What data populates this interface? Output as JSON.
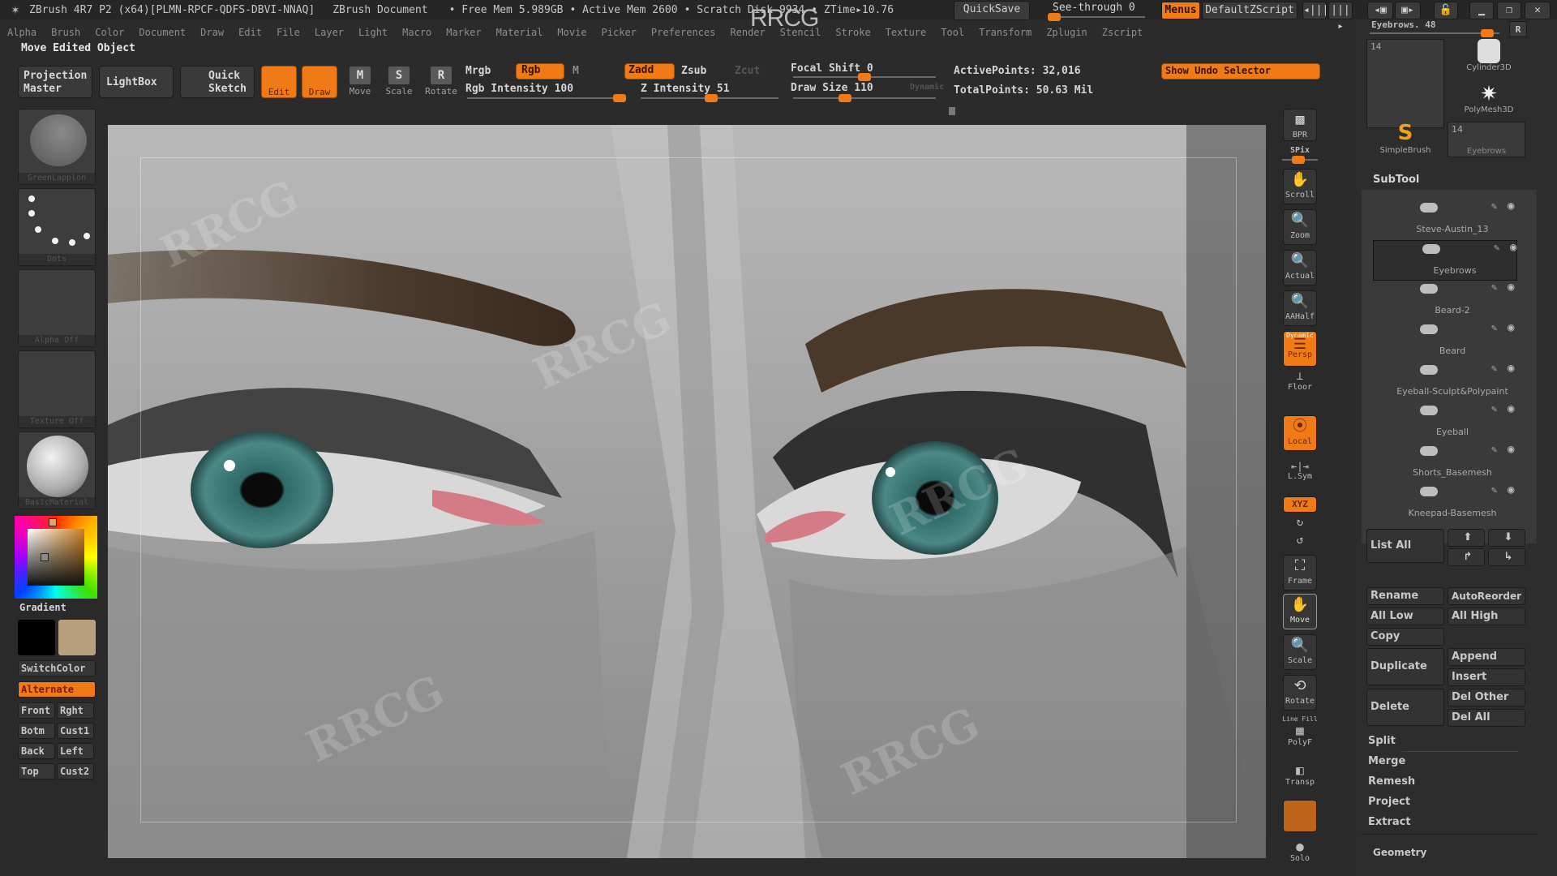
{
  "titlebar": {
    "app_title": "ZBrush 4R7 P2 (x64)[PLMN-RPCF-QDFS-DBVI-NNAQ]",
    "document": "ZBrush Document",
    "free_mem": "• Free Mem 5.989GB",
    "active_mem": "• Active Mem 2600",
    "scratch_disk": "• Scratch Disk 9934",
    "ztime": "• ZTime▸10.76",
    "quicksave": "QuickSave",
    "see_through_label": "See-through",
    "see_through_value": "0",
    "see_through_fraction": 0.0,
    "menus": "Menus",
    "default_zscript": "DefaultZScript",
    "watermark": "RRCG"
  },
  "menubar": [
    "Alpha",
    "Brush",
    "Color",
    "Document",
    "Draw",
    "Edit",
    "File",
    "Layer",
    "Light",
    "Macro",
    "Marker",
    "Material",
    "Movie",
    "Picker",
    "Preferences",
    "Render",
    "Stencil",
    "Stroke",
    "Texture",
    "Tool",
    "Transform",
    "Zplugin",
    "Zscript"
  ],
  "status_title": "Move Edited Object",
  "toolbar": {
    "projection_master": "Projection Master",
    "lightbox": "LightBox",
    "quick_sketch": "Quick Sketch",
    "edit": "Edit",
    "draw": "Draw",
    "move": "Move",
    "scale": "Scale",
    "rotate": "Rotate",
    "mrgb": "Mrgb",
    "rgb": "Rgb",
    "m": "M",
    "rgb_intensity_label": "Rgb Intensity",
    "rgb_intensity_value": "100",
    "rgb_intensity_fraction": 1.0,
    "zadd": "Zadd",
    "zsub": "Zsub",
    "zcut": "Zcut",
    "z_intensity_label": "Z Intensity",
    "z_intensity_value": "51",
    "z_intensity_fraction": 0.51,
    "focal_shift_label": "Focal Shift",
    "focal_shift_value": "0",
    "focal_shift_fraction": 0.5,
    "draw_size_label": "Draw Size",
    "draw_size_value": "110",
    "draw_size_fraction": 0.35,
    "dynamic": "Dynamic",
    "active_points": "ActivePoints: 32,016",
    "total_points": "TotalPoints: 50.63 Mil",
    "show_undo_selector": "Show Undo Selector"
  },
  "left_panel": {
    "brush_caption": "GreenLapplon",
    "stroke_caption": "Dots",
    "alpha_caption": "Alpha Off",
    "texture_caption": "Texture Off",
    "material_caption": "BasicMaterial",
    "gradient": "Gradient",
    "main_color": "#000000",
    "secondary_color": "#b8a07e",
    "switch_color": "SwitchColor",
    "alternate": "Alternate",
    "views": [
      "Front",
      "Rght",
      "Botm",
      "Cust1",
      "Back",
      "Left",
      "Top",
      "Cust2"
    ]
  },
  "shelf": {
    "bpr": "BPR",
    "spix": "SPix",
    "scroll": "Scroll",
    "zoom": "Zoom",
    "actual": "Actual",
    "aahalf": "AAHalf",
    "dynamic": "Dynamic",
    "persp": "Persp",
    "floor": "Floor",
    "local": "Local",
    "lsym": "L.Sym",
    "xyz": "XYZ",
    "frame": "Frame",
    "move": "Move",
    "scale": "Scale",
    "rotate": "Rotate",
    "line_fill": "Line Fill",
    "polyf": "PolyF",
    "transp": "Transp",
    "solo": "Solo"
  },
  "right_panel": {
    "tool_slider_label": "Eyebrows. 48",
    "tool_slider_fraction": 0.95,
    "r_button": "R",
    "tool_count_1": "14",
    "tool_count_2": "14",
    "tools": [
      "Cylinder3D",
      "PolyMesh3D",
      "SimpleBrush",
      "Eyebrows"
    ],
    "current_tool_caption": "Eyebrows",
    "subtool_header": "SubTool",
    "subtools": [
      "Steve-Austin_13",
      "Eyebrows",
      "Beard-2",
      "Beard",
      "Eyeball-Sculpt&Polypaint",
      "Eyeball",
      "Shorts_Basemesh",
      "Kneepad-Basemesh"
    ],
    "active_subtool_index": 1,
    "list_all": "List All",
    "rename": "Rename",
    "auto_reorder": "AutoReorder",
    "all_low": "All Low",
    "all_high": "All High",
    "copy": "Copy",
    "duplicate": "Duplicate",
    "append": "Append",
    "insert": "Insert",
    "delete": "Delete",
    "del_other": "Del Other",
    "del_all": "Del All",
    "split": "Split",
    "merge": "Merge",
    "remesh": "Remesh",
    "project": "Project",
    "extract": "Extract",
    "geometry": "Geometry"
  },
  "colors": {
    "accent": "#ef7a16",
    "panel_bg": "#2b2b2b",
    "iris": "#3f7e7c"
  }
}
